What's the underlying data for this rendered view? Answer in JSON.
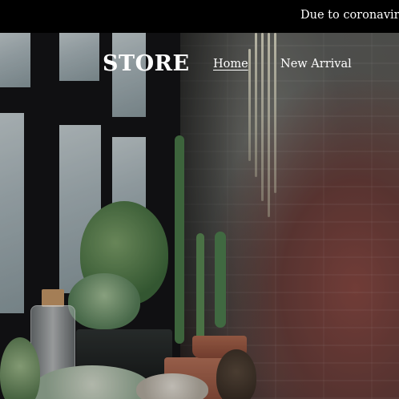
{
  "announcement": {
    "text": "Due to coronavirus"
  },
  "header": {
    "logo": "STORE",
    "nav": [
      {
        "label": "Home",
        "active": true
      },
      {
        "label": "New Arrival",
        "active": false
      }
    ]
  },
  "hero": {
    "image": "plants-by-window-photo"
  }
}
